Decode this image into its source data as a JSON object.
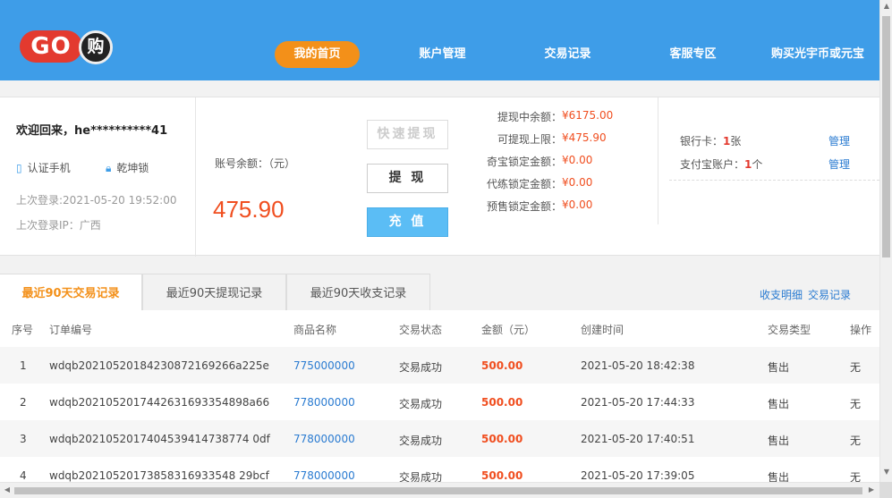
{
  "logo": {
    "go": "GO",
    "gou": "购"
  },
  "nav": [
    {
      "label": "我的首页",
      "active": true
    },
    {
      "label": "账户管理",
      "active": false
    },
    {
      "label": "交易记录",
      "active": false
    },
    {
      "label": "客服专区",
      "active": false
    },
    {
      "label": "购买光宇币或元宝",
      "active": false
    }
  ],
  "user": {
    "welcome": "欢迎回来，he**********41",
    "phone_badge": "认证手机",
    "lock_badge": "乾坤锁",
    "last_login": "上次登录:2021-05-20 19:52:00",
    "last_ip": "上次登录IP：广西"
  },
  "balance": {
    "label": "账号余额：（元）",
    "value": "475.90"
  },
  "buttons": {
    "quick_withdraw": "快速提现",
    "withdraw": "提 现",
    "recharge": "充 值"
  },
  "stats": [
    {
      "label": "提现中余额：",
      "value": "¥6175.00"
    },
    {
      "label": "可提现上限：",
      "value": "¥475.90"
    },
    {
      "label": "奇宝锁定金额：",
      "value": "¥0.00"
    },
    {
      "label": "代练锁定金额：",
      "value": "¥0.00"
    },
    {
      "label": "预售锁定金额：",
      "value": "¥0.00"
    }
  ],
  "accounts": {
    "bank_prefix": "银行卡：",
    "bank_count": "1",
    "bank_suffix": "张",
    "alipay_prefix": "支付宝账户：",
    "alipay_count": "1",
    "alipay_suffix": "个",
    "manage": "管理"
  },
  "tabs": [
    {
      "label": "最近90天交易记录",
      "active": true
    },
    {
      "label": "最近90天提现记录",
      "active": false
    },
    {
      "label": "最近90天收支记录",
      "active": false
    }
  ],
  "tab_links": {
    "income": "收支明细",
    "trade": "交易记录"
  },
  "table": {
    "headers": [
      "序号",
      "订单编号",
      "商品名称",
      "交易状态",
      "金额（元）",
      "创建时间",
      "交易类型",
      "操作"
    ],
    "rows": [
      {
        "no": "1",
        "order": "wdqb20210520184230872169266a225e",
        "item": "775000000",
        "status": "交易成功",
        "amount": "500.00",
        "time": "2021-05-20 18:42:38",
        "type": "售出",
        "op": "无"
      },
      {
        "no": "2",
        "order": "wdqb2021052017442631693354898a66",
        "item": "778000000",
        "status": "交易成功",
        "amount": "500.00",
        "time": "2021-05-20 17:44:33",
        "type": "售出",
        "op": "无"
      },
      {
        "no": "3",
        "order": "wdqb2021052017404539414738774 0df",
        "item": "778000000",
        "status": "交易成功",
        "amount": "500.00",
        "time": "2021-05-20 17:40:51",
        "type": "售出",
        "op": "无"
      },
      {
        "no": "4",
        "order": "wdqb20210520173858316933548 29bcf",
        "item": "778000000",
        "status": "交易成功",
        "amount": "500.00",
        "time": "2021-05-20 17:39:05",
        "type": "售出",
        "op": "无"
      }
    ]
  }
}
